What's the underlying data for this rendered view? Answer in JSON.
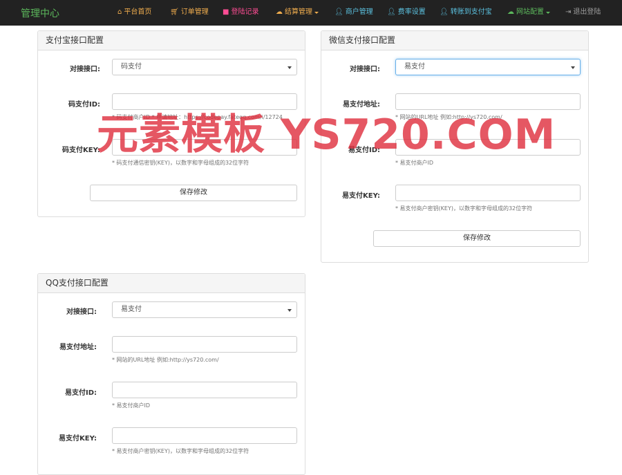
{
  "app": {
    "title": "管理中心"
  },
  "nav": {
    "items": [
      {
        "label": "平台首页",
        "icon": "home-icon",
        "color": "#f0ad4e"
      },
      {
        "label": "订单管理",
        "icon": "cart-icon",
        "color": "#f0ad4e"
      },
      {
        "label": "登陆记录",
        "icon": "camera-icon",
        "color": "#ff4d94"
      },
      {
        "label": "结算管理",
        "icon": "cloud-icon",
        "color": "#f0ad4e",
        "dropdown": true
      },
      {
        "label": "商户管理",
        "icon": "user-icon",
        "color": "#5bc0de"
      },
      {
        "label": "费率设置",
        "icon": "user-icon",
        "color": "#5bc0de"
      },
      {
        "label": "转账到支付宝",
        "icon": "user-icon",
        "color": "#5bc0de"
      },
      {
        "label": "网站配置",
        "icon": "cloud-icon",
        "color": "#5cb85c",
        "dropdown": true
      },
      {
        "label": "退出登陆",
        "icon": "logout-icon",
        "color": "#9d9d9d"
      }
    ]
  },
  "alipay": {
    "title": "支付宝接口配置",
    "iface_label": "对接接口:",
    "iface_value": "码支付",
    "id_label": "码支付ID:",
    "id_help": "* 码支付商户ID * 申请地址：https://codepay.fateqq.com/i/12724",
    "key_label": "码支付KEY:",
    "key_help": "* 码支付通信密钥(KEY)，以数字和字母组成的32位字符",
    "save": "保存修改"
  },
  "wechat": {
    "title": "微信支付接口配置",
    "iface_label": "对接接口:",
    "iface_value": "易支付",
    "url_label": "易支付地址:",
    "url_help": "* 网站的URL地址 例如:http://ys720.com/",
    "id_label": "易支付ID:",
    "id_help": "* 易支付商户ID",
    "key_label": "易支付KEY:",
    "key_help": "* 易支付商户密钥(KEY)，以数字和字母组成的32位字符",
    "save": "保存修改"
  },
  "qq": {
    "title": "QQ支付接口配置",
    "iface_label": "对接接口:",
    "iface_value": "易支付",
    "url_label": "易支付地址:",
    "url_help": "* 网站的URL地址 例如:http://ys720.com/",
    "id_label": "易支付ID:",
    "id_help": "* 易支付商户ID",
    "key_label": "易支付KEY:",
    "key_help": "* 易支付商户密钥(KEY)，以数字和字母组成的32位字符"
  },
  "watermark": "元素模板 YS720.COM"
}
